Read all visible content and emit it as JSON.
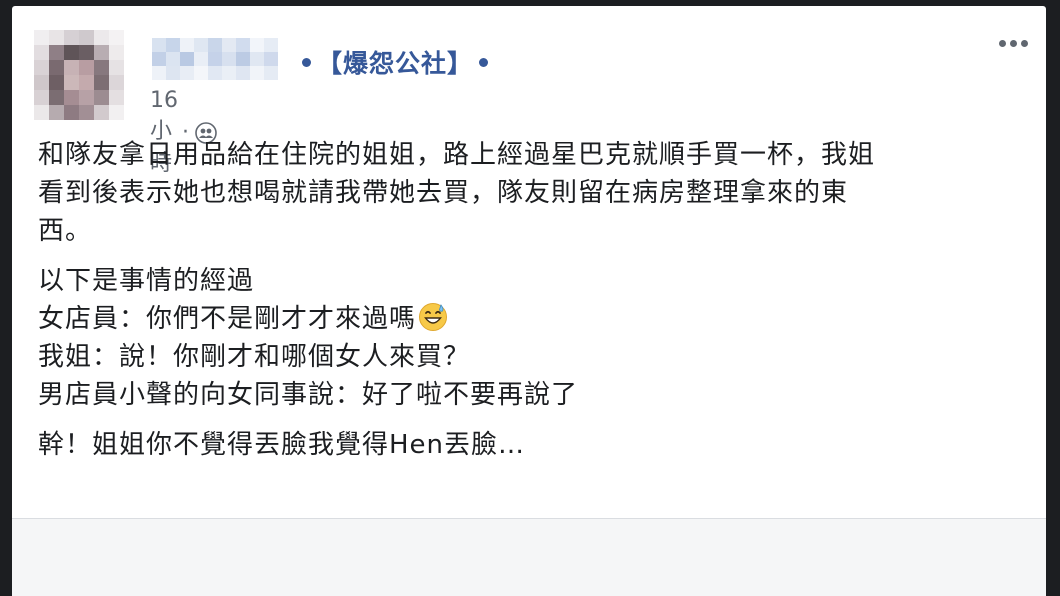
{
  "post": {
    "group_name": "【爆怨公社】",
    "timestamp": "16 小時",
    "separator": "·",
    "privacy_icon": "group-members-icon",
    "more_icon": "more-options-icon",
    "paragraphs": [
      {
        "lines": [
          "和隊友拿日用品給在住院的姐姐，路上經過星巴克就順手買一杯，我姐",
          "看到後表示她也想喝就請我帶她去買，隊友則留在病房整理拿來的東",
          "西。"
        ]
      },
      {
        "lines": [
          "以下是事情的經過",
          "女店員：你們不是剛才才來過嗎",
          "我姐：說！你剛才和哪個女人來買？",
          "男店員小聲的向女同事說：好了啦不要再說了"
        ],
        "emoji": "grinning-sweat-emoji"
      },
      {
        "lines": [
          "幹！姐姐你不覺得丟臉我覺得Hen丟臉…"
        ]
      }
    ]
  },
  "colors": {
    "link": "#365899",
    "text": "#1c1e21",
    "meta": "#616770",
    "card": "#ffffff",
    "background": "#1c1e21"
  }
}
